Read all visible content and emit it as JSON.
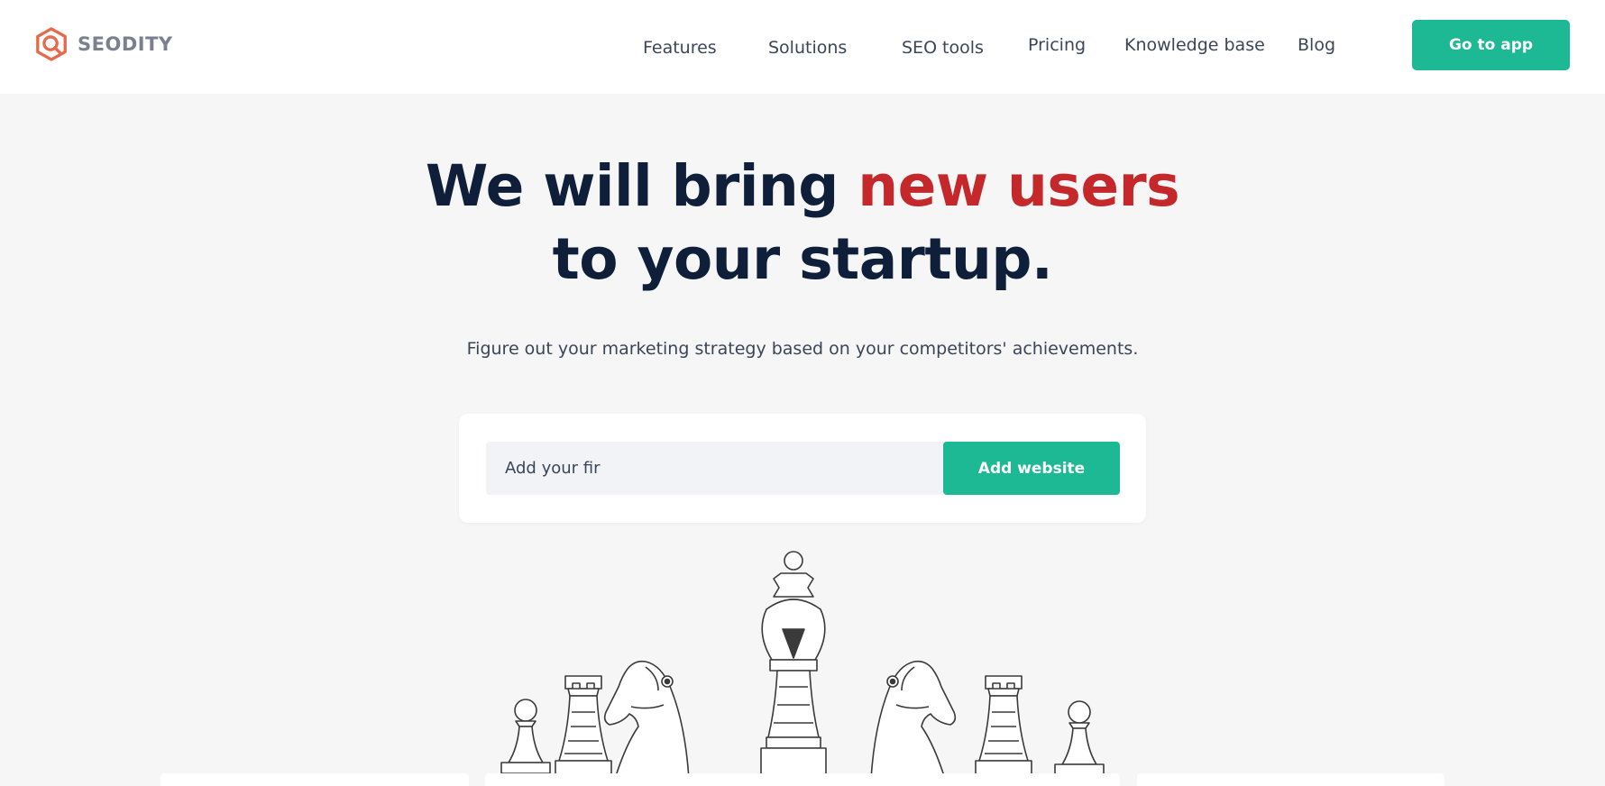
{
  "brand": {
    "name": "SEODITY",
    "accent_color": "#e8694a"
  },
  "nav": {
    "items": [
      {
        "label": "Features"
      },
      {
        "label": "Solutions"
      },
      {
        "label": "SEO tools"
      },
      {
        "label": "Pricing"
      },
      {
        "label": "Knowledge base"
      },
      {
        "label": "Blog"
      }
    ],
    "cta_label": "Go to app"
  },
  "hero": {
    "title_part1": "We will bring ",
    "title_accent": "new users",
    "title_part2": "to your startup.",
    "subtitle": "Figure out your marketing strategy based on your competitors' achievements."
  },
  "form": {
    "input_value": "Add your fir",
    "button_label": "Add website"
  },
  "colors": {
    "primary": "#1db894",
    "headline": "#0f1f3a",
    "accent": "#c4282a",
    "background": "#f6f6f7"
  },
  "illustration": {
    "icon": "chess-pieces-illustration"
  }
}
